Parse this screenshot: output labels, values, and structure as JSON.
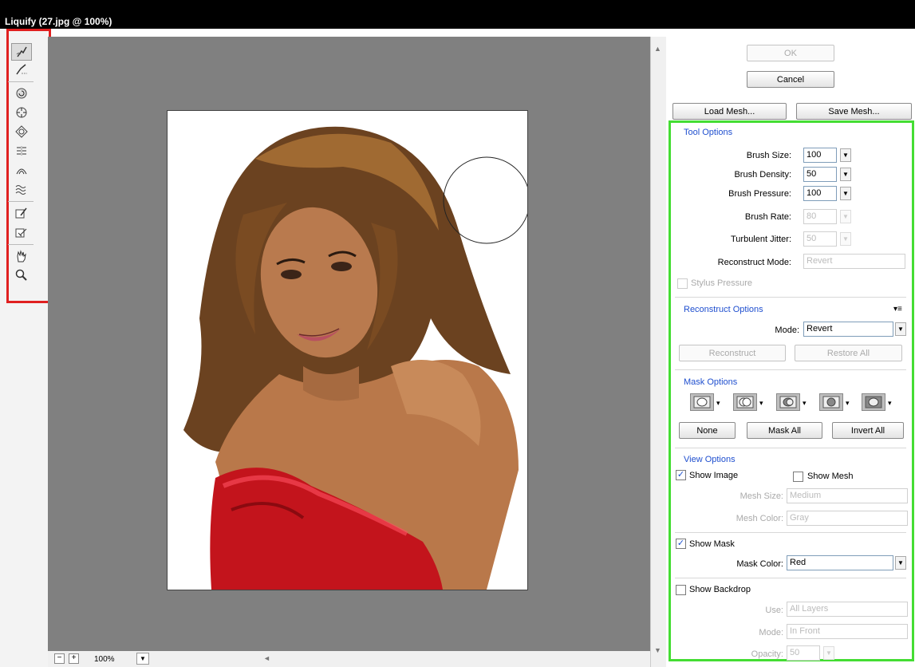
{
  "window": {
    "title": "Liquify (27.jpg @ 100%)"
  },
  "tools": [
    {
      "name": "forward-warp-tool-icon"
    },
    {
      "name": "reconstruct-tool-icon"
    },
    {
      "name": "twirl-clockwise-tool-icon"
    },
    {
      "name": "pucker-tool-icon"
    },
    {
      "name": "bloat-tool-icon"
    },
    {
      "name": "push-left-tool-icon"
    },
    {
      "name": "mirror-tool-icon"
    },
    {
      "name": "turbulence-tool-icon"
    },
    {
      "name": "freeze-mask-tool-icon"
    },
    {
      "name": "thaw-mask-tool-icon"
    },
    {
      "name": "hand-tool-icon"
    },
    {
      "name": "zoom-tool-icon"
    }
  ],
  "buttons": {
    "ok": "OK",
    "cancel": "Cancel",
    "load_mesh": "Load Mesh...",
    "save_mesh": "Save Mesh...",
    "reconstruct": "Reconstruct",
    "restore_all": "Restore All",
    "none": "None",
    "mask_all": "Mask All",
    "invert_all": "Invert All"
  },
  "tool_options": {
    "heading": "Tool Options",
    "brush_size": {
      "label": "Brush Size:",
      "value": "100"
    },
    "brush_density": {
      "label": "Brush Density:",
      "value": "50"
    },
    "brush_pressure": {
      "label": "Brush Pressure:",
      "value": "100"
    },
    "brush_rate": {
      "label": "Brush Rate:",
      "value": "80"
    },
    "turbulent_jitter": {
      "label": "Turbulent Jitter:",
      "value": "50"
    },
    "reconstruct_mode": {
      "label": "Reconstruct Mode:",
      "value": "Revert"
    },
    "stylus_pressure": {
      "label": "Stylus Pressure",
      "checked": false
    }
  },
  "reconstruct_options": {
    "heading": "Reconstruct Options",
    "mode": {
      "label": "Mode:",
      "value": "Revert"
    }
  },
  "mask_options": {
    "heading": "Mask Options",
    "mode_buttons": [
      "replace-selection-icon",
      "add-to-selection-icon",
      "subtract-from-selection-icon",
      "intersect-with-selection-icon",
      "invert-selection-icon"
    ]
  },
  "view_options": {
    "heading": "View Options",
    "show_image": {
      "label": "Show Image",
      "checked": true
    },
    "show_mesh": {
      "label": "Show Mesh",
      "checked": false
    },
    "mesh_size": {
      "label": "Mesh Size:",
      "value": "Medium"
    },
    "mesh_color": {
      "label": "Mesh Color:",
      "value": "Gray"
    },
    "show_mask": {
      "label": "Show Mask",
      "checked": true
    },
    "mask_color": {
      "label": "Mask Color:",
      "value": "Red"
    },
    "show_backdrop": {
      "label": "Show Backdrop",
      "checked": false
    },
    "use": {
      "label": "Use:",
      "value": "All Layers"
    },
    "mode": {
      "label": "Mode:",
      "value": "In Front"
    },
    "opacity": {
      "label": "Opacity:",
      "value": "50"
    }
  },
  "zoom": {
    "minus": "−",
    "plus": "+",
    "value": "100%"
  },
  "colors": {
    "highlight_red": "#e02020",
    "highlight_green": "#44dd33",
    "section_blue": "#1f4fcf",
    "canvas_gray": "#808080"
  }
}
